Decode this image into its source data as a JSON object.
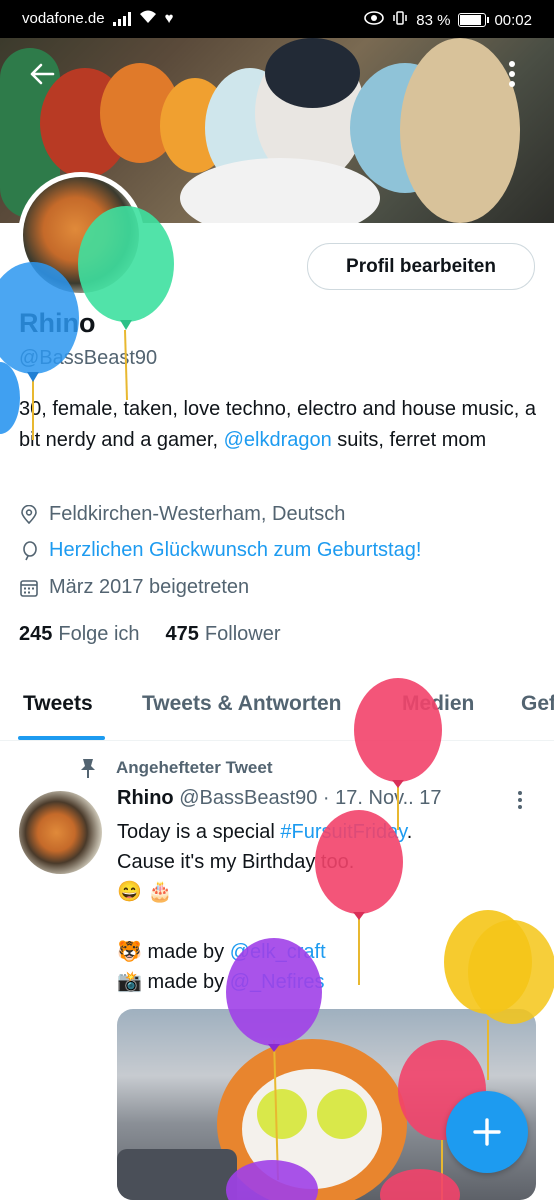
{
  "status_bar": {
    "carrier": "vodafone.de",
    "battery": "83 %",
    "time": "00:02"
  },
  "profile": {
    "name": "Rhino",
    "handle": "@BassBeast90",
    "edit_button": "Profil bearbeiten",
    "bio_part1": "30, female, taken, love techno, electro and house music, a bit nerdy and a gamer, ",
    "bio_link": "@elkdragon",
    "bio_part2": " suits, ferret mom",
    "location": "Feldkirchen-Westerham, Deutsch",
    "birthday": "Herzlichen Glückwunsch zum Geburtstag!",
    "joined": "März 2017 beigetreten",
    "following_count": "245",
    "following_label": "Folge ich",
    "followers_count": "475",
    "followers_label": "Follower"
  },
  "tabs": [
    "Tweets",
    "Tweets & Antworten",
    "Medien",
    "Gef"
  ],
  "pinned_tweet": {
    "pinned_label": "Angehefteter Tweet",
    "author": "Rhino",
    "meta": "@BassBeast90 · 17. Nov.. 17",
    "line1_prefix": "Today is a special ",
    "line1_hashtag": "#FursuitFriday",
    "line1_suffix": ".",
    "line2": "Cause it's my Birthday too.",
    "line3": "😄 🎂",
    "line4_prefix": "🐯 made by ",
    "line4_link": "@elk_craft",
    "line5_prefix": "📸 made by ",
    "line5_link": "@_Nefires"
  },
  "colors": {
    "accent": "#1d9bf0",
    "text": "#0f1419",
    "muted": "#536471"
  },
  "icons": {
    "back": "arrow-left-icon",
    "more": "more-vertical-icon",
    "location": "location-pin-icon",
    "balloon": "balloon-icon",
    "calendar": "calendar-icon",
    "pin": "pin-icon",
    "compose": "plus-icon"
  }
}
